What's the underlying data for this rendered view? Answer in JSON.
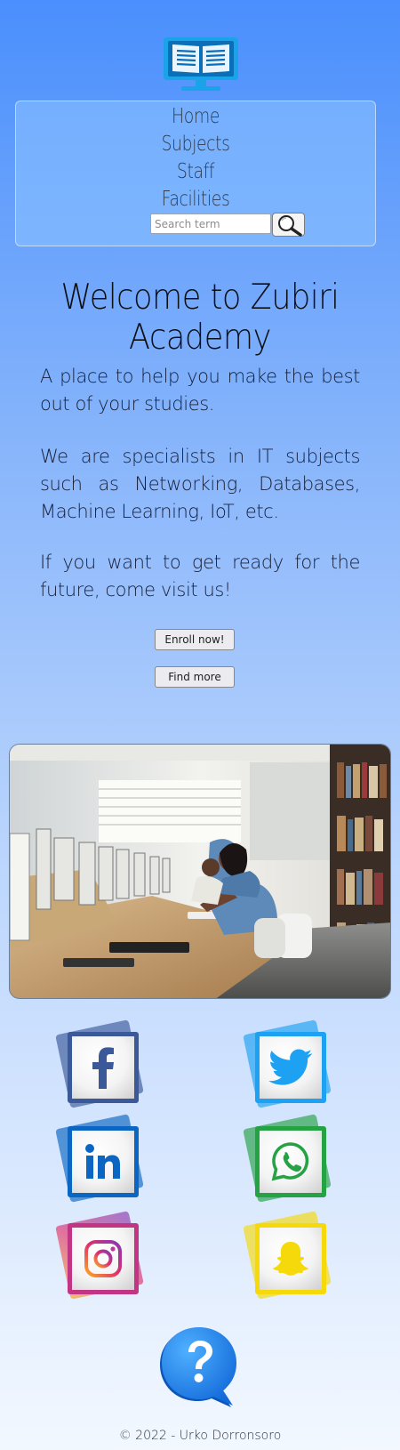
{
  "header": {
    "logo_icon": "open-book-monitor-icon"
  },
  "nav": {
    "items": [
      {
        "label": "Home"
      },
      {
        "label": "Subjects"
      },
      {
        "label": "Staff"
      },
      {
        "label": "Facilities"
      }
    ],
    "search": {
      "placeholder": "Search term",
      "icon": "magnifier-icon"
    }
  },
  "main": {
    "title": "Welcome to Zubiri Academy",
    "paragraphs": [
      "A place to help you make the best out of your studies.",
      "We are specialists in IT subjects such as Networking, Databases, Machine Learning, IoT, etc.",
      "If you want to get ready for the future, come visit us!"
    ],
    "buttons": {
      "enroll": "Enroll now!",
      "find_more": "Find more"
    }
  },
  "social": [
    {
      "name": "facebook",
      "icon": "facebook-icon",
      "color": "#3b5998"
    },
    {
      "name": "twitter",
      "icon": "twitter-icon",
      "color": "#1da1f2"
    },
    {
      "name": "linkedin",
      "icon": "linkedin-icon",
      "color": "#0a66c2"
    },
    {
      "name": "whatsapp",
      "icon": "whatsapp-icon",
      "color": "#25a244"
    },
    {
      "name": "instagram",
      "icon": "instagram-icon",
      "color": "#c13584"
    },
    {
      "name": "snapchat",
      "icon": "snapchat-icon",
      "color": "#f5d90a"
    }
  ],
  "help": {
    "icon": "question-bubble-icon"
  },
  "footer": {
    "text": "©  2022 - Urko Dorronsoro"
  }
}
